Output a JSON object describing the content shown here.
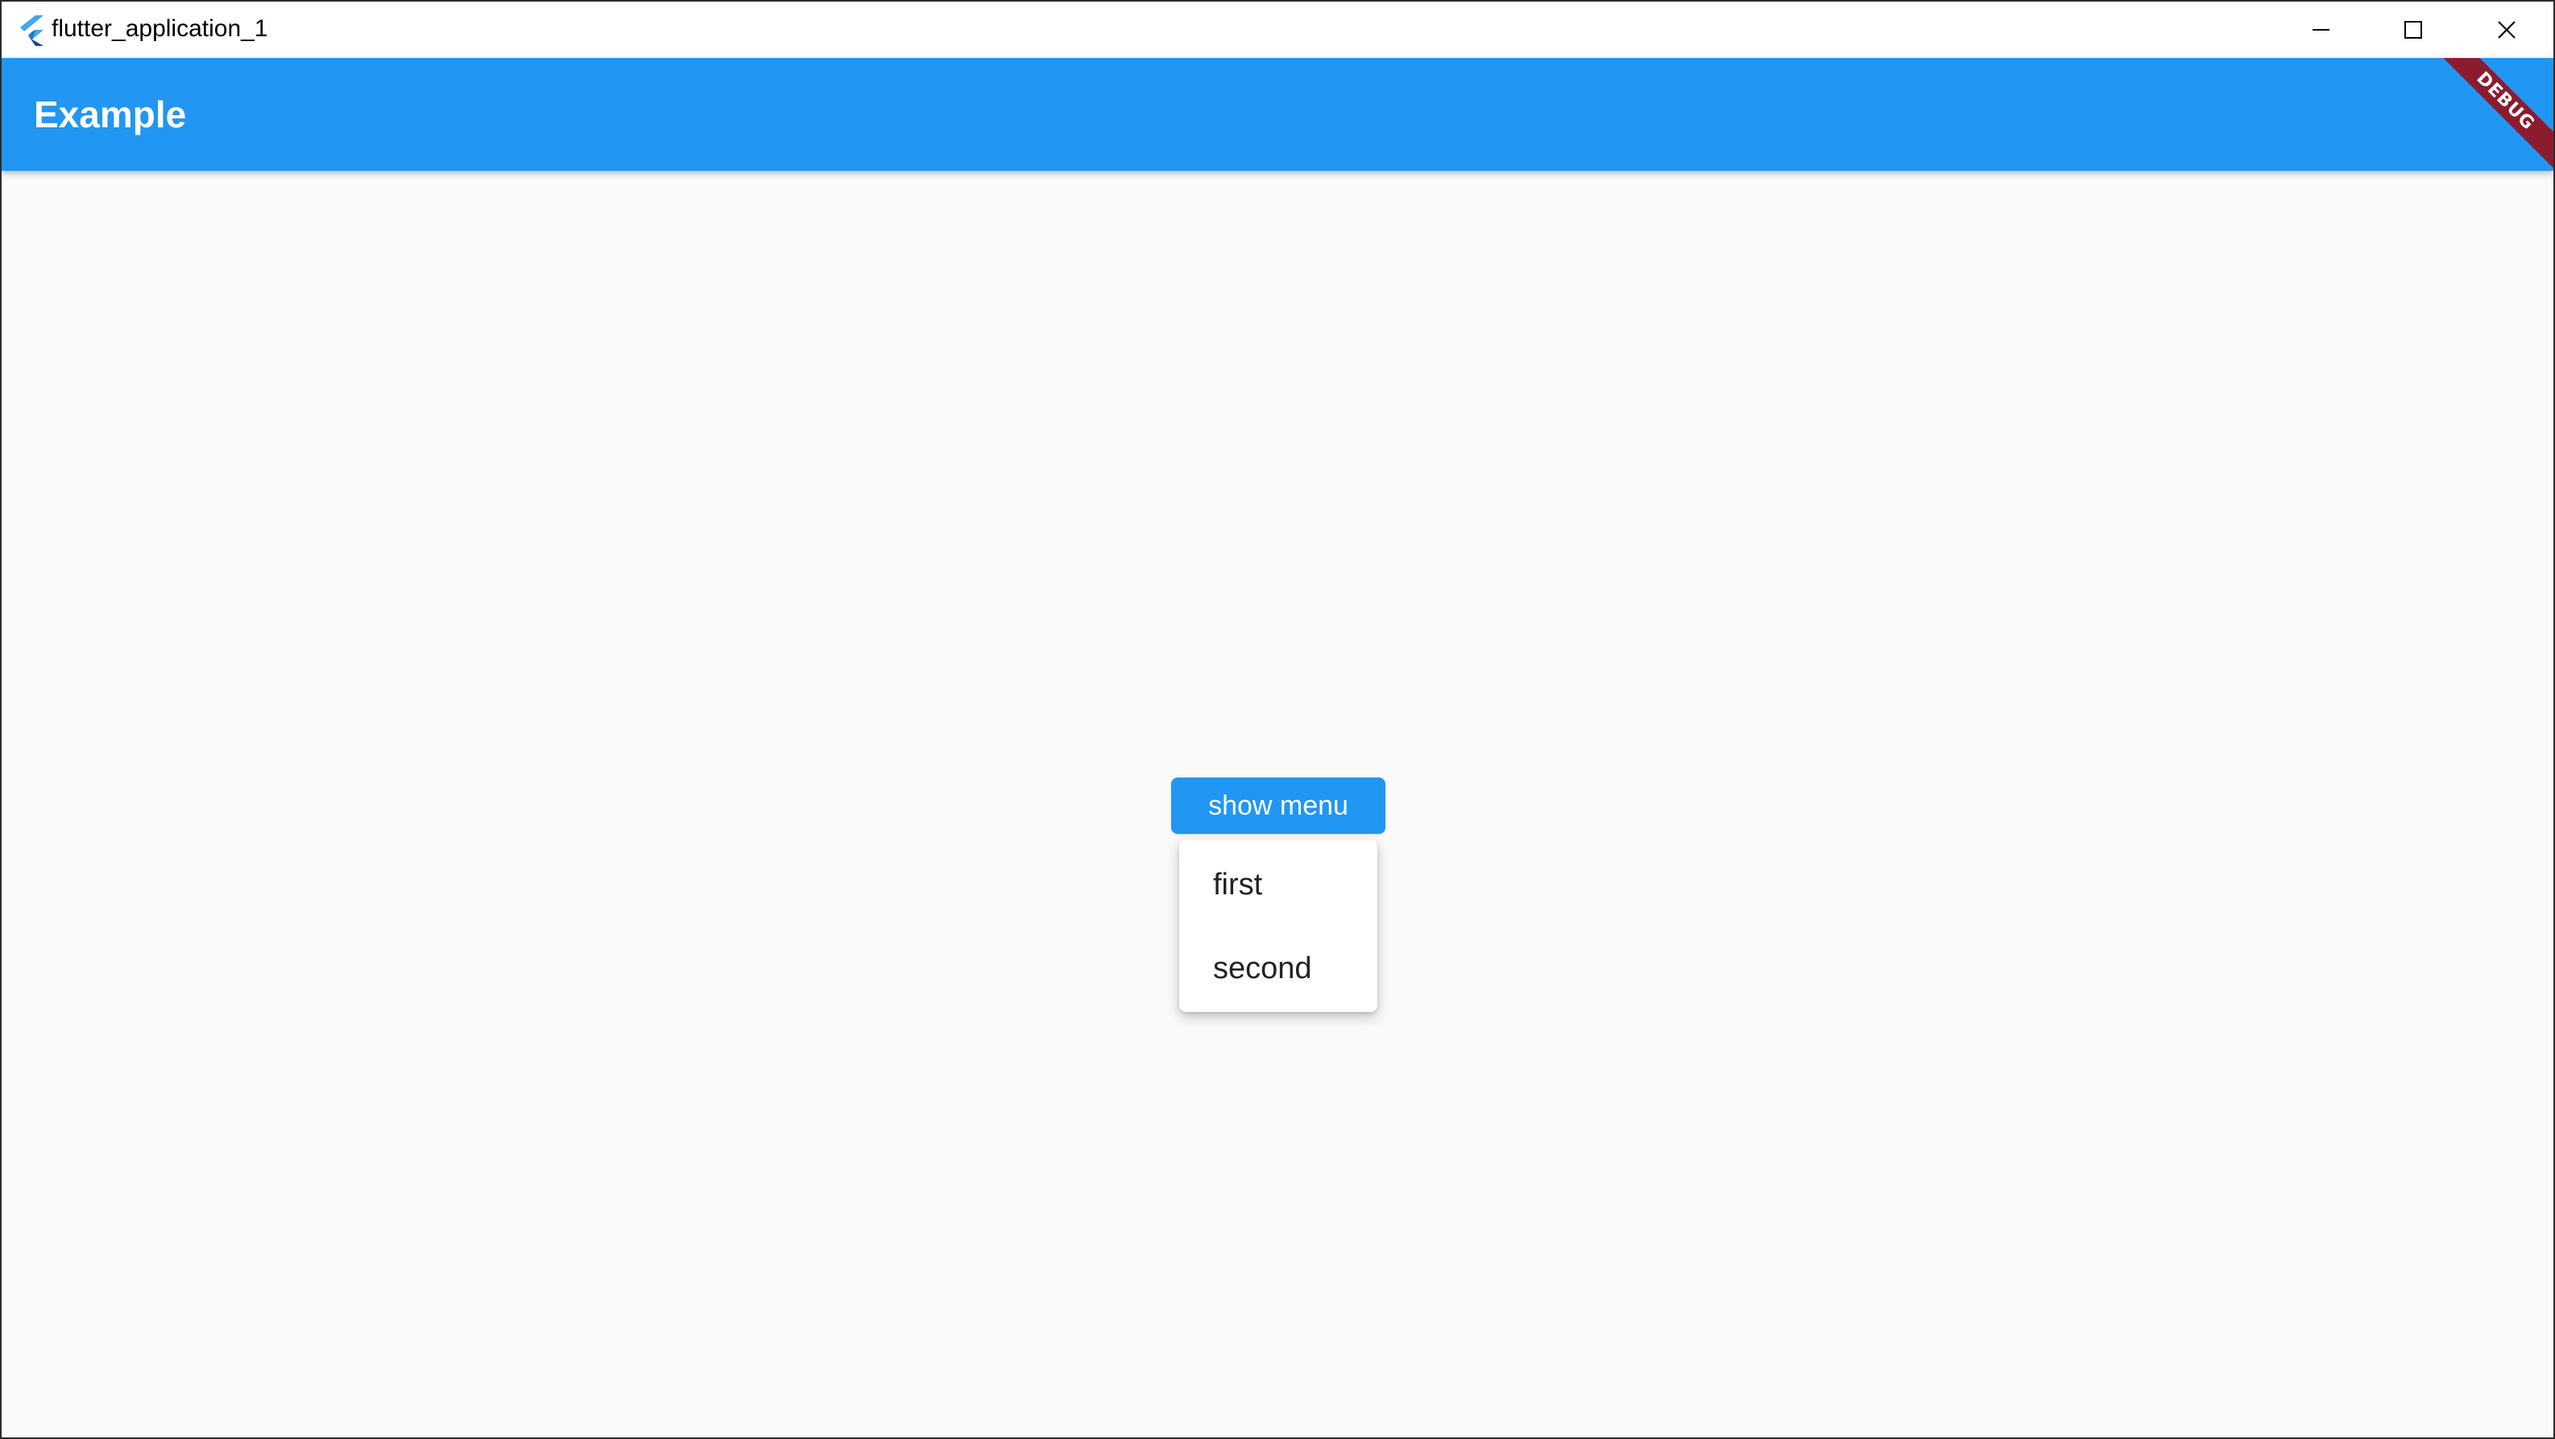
{
  "window": {
    "title": "flutter_application_1",
    "icon": "flutter-logo-icon",
    "controls": {
      "minimize_icon": "minimize-icon",
      "maximize_icon": "maximize-icon",
      "close_icon": "close-icon"
    }
  },
  "appbar": {
    "title": "Example",
    "debug_banner": "DEBUG",
    "color": "#2196f3"
  },
  "main": {
    "show_menu_label": "show menu",
    "menu": {
      "items": [
        {
          "label": "first"
        },
        {
          "label": "second"
        }
      ]
    }
  },
  "colors": {
    "accent": "#2196f3",
    "background": "#fafafa",
    "debug_banner": "#8b1c30"
  }
}
